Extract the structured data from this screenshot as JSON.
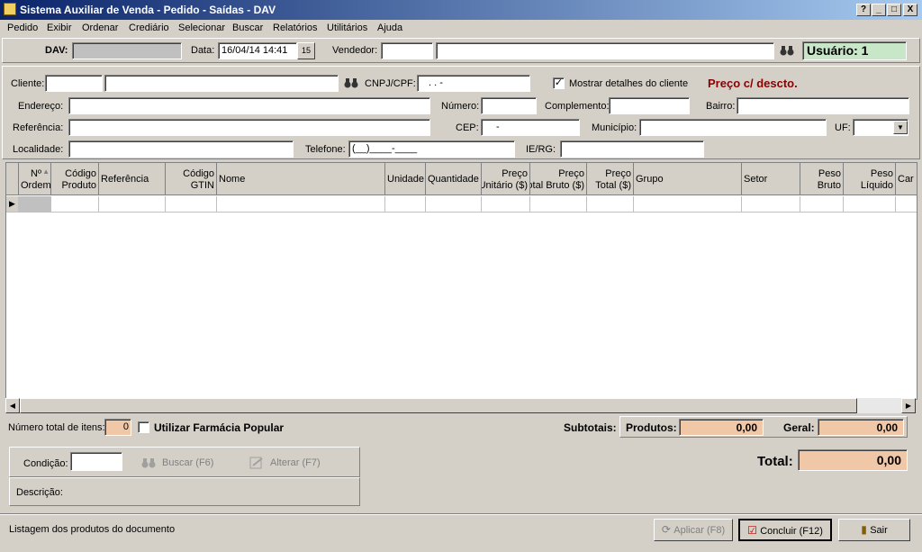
{
  "window": {
    "title": "Sistema Auxiliar de Venda - Pedido - Saídas - DAV",
    "btn_help": "?",
    "btn_min": "_",
    "btn_max": "□",
    "btn_close": "X"
  },
  "menu": [
    "Pedido",
    "Exibir",
    "Ordenar",
    "Crediário",
    "Selecionar",
    "Buscar",
    "Relatórios",
    "Utilitários",
    "Ajuda"
  ],
  "header": {
    "dav_label": "DAV:",
    "data_label": "Data:",
    "data_value": "16/04/14 14:41",
    "calendar_icon": "15",
    "vendedor_label": "Vendedor:",
    "usuario": "Usuário: 1"
  },
  "client": {
    "cliente_label": "Cliente:",
    "cnpj_label": "CNPJ/CPF:",
    "cnpj_mask": ". . -",
    "mostrar_label": "Mostrar detalhes do cliente",
    "mostrar_checked": "✓",
    "preco_label": "Preço c/ descto.",
    "endereco_label": "Endereço:",
    "numero_label": "Número:",
    "complemento_label": "Complemento:",
    "bairro_label": "Bairro:",
    "referencia_label": "Referência:",
    "cep_label": "CEP:",
    "cep_mask": "-",
    "municipio_label": "Município:",
    "uf_label": "UF:",
    "localidade_label": "Localidade:",
    "telefone_label": "Telefone:",
    "telefone_mask": "(__)____-____",
    "ie_label": "IE/RG:"
  },
  "grid": {
    "columns": [
      {
        "l1": "Nº",
        "l2": "Ordem"
      },
      {
        "l1": "Código",
        "l2": "Produto"
      },
      {
        "l1": "",
        "l2": "Referência"
      },
      {
        "l1": "Código",
        "l2": "GTIN"
      },
      {
        "l1": "",
        "l2": "Nome"
      },
      {
        "l1": "",
        "l2": "Unidade"
      },
      {
        "l1": "",
        "l2": "Quantidade"
      },
      {
        "l1": "Preço",
        "l2": "Unitário ($)"
      },
      {
        "l1": "Preço",
        "l2": "Total Bruto ($)"
      },
      {
        "l1": "Preço",
        "l2": "Total ($)"
      },
      {
        "l1": "",
        "l2": "Grupo"
      },
      {
        "l1": "",
        "l2": "Setor"
      },
      {
        "l1": "Peso",
        "l2": "Bruto"
      },
      {
        "l1": "Peso",
        "l2": "Líquido"
      },
      {
        "l1": "",
        "l2": "Car"
      }
    ],
    "row_pointer": "▶",
    "sort_icon": "▲"
  },
  "totals": {
    "num_itens_label": "Número total de itens:",
    "num_itens_value": "0",
    "farmacia_label": "Utilizar Farmácia Popular",
    "subtotais_label": "Subtotais:",
    "produtos_label": "Produtos:",
    "produtos_value": "0,00",
    "geral_label": "Geral:",
    "geral_value": "0,00",
    "total_label": "Total:",
    "total_value": "0,00"
  },
  "payment": {
    "condicao_label": "Condição:",
    "buscar_label": "Buscar (F6)",
    "alterar_label": "Alterar (F7)",
    "descricao_label": "Descrição:"
  },
  "footer": {
    "status": "Listagem dos produtos do documento",
    "aplicar_label": "Aplicar (F8)",
    "concluir_label": "Concluir (F12)",
    "sair_label": "Sair"
  }
}
